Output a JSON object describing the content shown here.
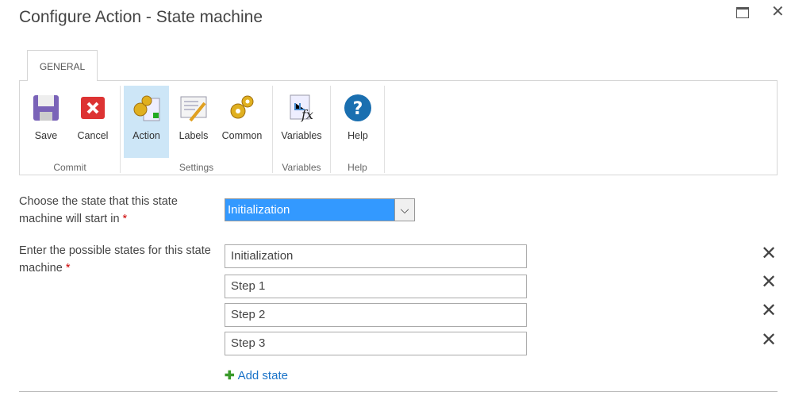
{
  "window": {
    "title": "Configure Action - State machine",
    "maximize_icon": "maximize-icon",
    "close_icon": "close-icon"
  },
  "ribbon": {
    "tab": "GENERAL",
    "groups": [
      {
        "label": "Commit",
        "buttons": [
          {
            "label": "Save",
            "icon": "floppy-disk-icon"
          },
          {
            "label": "Cancel",
            "icon": "red-x-icon"
          }
        ]
      },
      {
        "label": "Settings",
        "buttons": [
          {
            "label": "Action",
            "icon": "gears-document-icon",
            "selected": true
          },
          {
            "label": "Labels",
            "icon": "document-pencil-icon"
          },
          {
            "label": "Common",
            "icon": "gears-icon"
          }
        ]
      },
      {
        "label": "Variables",
        "buttons": [
          {
            "label": "Variables",
            "icon": "fx-diagram-icon"
          }
        ]
      },
      {
        "label": "Help",
        "buttons": [
          {
            "label": "Help",
            "icon": "question-circle-icon"
          }
        ]
      }
    ]
  },
  "form": {
    "start_state": {
      "label": "Choose the state that this state machine will start in",
      "required": "*",
      "value": "Initialization"
    },
    "states": {
      "label": "Enter the possible states for this state machine",
      "required": "*",
      "values": [
        "Initialization",
        "Step 1",
        "Step 2",
        "Step 3"
      ]
    },
    "add_state": "Add state"
  },
  "colors": {
    "selection": "#3399ff",
    "link": "#1a73c8",
    "selected_button": "#cde6f7"
  }
}
